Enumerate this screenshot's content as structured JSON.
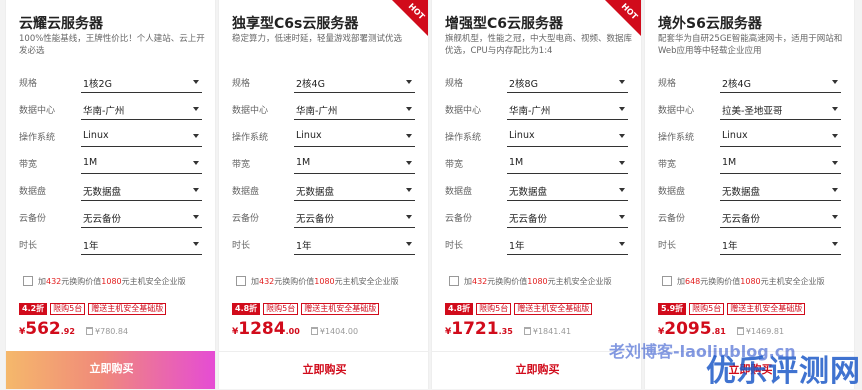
{
  "cards": [
    {
      "title": "云耀云服务器",
      "desc": "100%性能基线，王牌性价比！个人建站、云上开发必选",
      "hot": false,
      "specs": [
        {
          "label": "规格",
          "value": "1核2G"
        },
        {
          "label": "数据中心",
          "value": "华南-广州"
        },
        {
          "label": "操作系统",
          "value": "Linux"
        },
        {
          "label": "带宽",
          "value": "1M"
        },
        {
          "label": "数据盘",
          "value": "无数据盘"
        },
        {
          "label": "云备份",
          "value": "无云备份"
        },
        {
          "label": "时长",
          "value": "1年"
        }
      ],
      "addon": {
        "pre": "加",
        "price": "432",
        "mid": "元换购价值",
        "value": "1080",
        "post": "元主机安全企业版"
      },
      "discount": "4.2折",
      "tag_limit": "限购5台",
      "tag_gift": "赠送主机安全基础版",
      "price_cur": "¥",
      "price_int": "562",
      "price_dec": ".92",
      "orig_price": "¥780.84",
      "buy_label": "立即购买",
      "primary": true
    },
    {
      "title": "独享型C6s云服务器",
      "desc": "稳定算力，低速时延，轻量游戏部署测试优选",
      "hot": true,
      "specs": [
        {
          "label": "规格",
          "value": "2核4G"
        },
        {
          "label": "数据中心",
          "value": "华南-广州"
        },
        {
          "label": "操作系统",
          "value": "Linux"
        },
        {
          "label": "带宽",
          "value": "1M"
        },
        {
          "label": "数据盘",
          "value": "无数据盘"
        },
        {
          "label": "云备份",
          "value": "无云备份"
        },
        {
          "label": "时长",
          "value": "1年"
        }
      ],
      "addon": {
        "pre": "加",
        "price": "432",
        "mid": "元换购价值",
        "value": "1080",
        "post": "元主机安全企业版"
      },
      "discount": "4.8折",
      "tag_limit": "限购5台",
      "tag_gift": "赠送主机安全基础版",
      "price_cur": "¥",
      "price_int": "1284",
      "price_dec": ".00",
      "orig_price": "¥1404.00",
      "buy_label": "立即购买",
      "primary": false
    },
    {
      "title": "增强型C6云服务器",
      "desc": "旗舰机型，性能之冠，中大型电商、视频、数据库优选，CPU与内存配比为1:4",
      "hot": true,
      "specs": [
        {
          "label": "规格",
          "value": "2核8G"
        },
        {
          "label": "数据中心",
          "value": "华南-广州"
        },
        {
          "label": "操作系统",
          "value": "Linux"
        },
        {
          "label": "带宽",
          "value": "1M"
        },
        {
          "label": "数据盘",
          "value": "无数据盘"
        },
        {
          "label": "云备份",
          "value": "无云备份"
        },
        {
          "label": "时长",
          "value": "1年"
        }
      ],
      "addon": {
        "pre": "加",
        "price": "432",
        "mid": "元换购价值",
        "value": "1080",
        "post": "元主机安全企业版"
      },
      "discount": "4.8折",
      "tag_limit": "限购5台",
      "tag_gift": "赠送主机安全基础版",
      "price_cur": "¥",
      "price_int": "1721",
      "price_dec": ".35",
      "orig_price": "¥1841.41",
      "buy_label": "立即购买",
      "primary": false
    },
    {
      "title": "境外S6云服务器",
      "desc": "配套华为自研25GE智能高速网卡，适用于网站和Web应用等中轻载企业应用",
      "hot": false,
      "specs": [
        {
          "label": "规格",
          "value": "2核4G"
        },
        {
          "label": "数据中心",
          "value": "拉美-圣地亚哥"
        },
        {
          "label": "操作系统",
          "value": "Linux"
        },
        {
          "label": "带宽",
          "value": "1M"
        },
        {
          "label": "数据盘",
          "value": "无数据盘"
        },
        {
          "label": "云备份",
          "value": "无云备份"
        },
        {
          "label": "时长",
          "value": "1年"
        }
      ],
      "addon": {
        "pre": "加",
        "price": "648",
        "mid": "元换购价值",
        "value": "1080",
        "post": "元主机安全企业版"
      },
      "discount": "5.9折",
      "tag_limit": "限购5台",
      "tag_gift": "赠送主机安全基础版",
      "price_cur": "¥",
      "price_int": "2095",
      "price_dec": ".81",
      "orig_price": "¥1469.81",
      "buy_label": "立即购买",
      "primary": false
    }
  ],
  "hot_label": "HOT",
  "watermark_small": "老刘博客-laoliublog.cn",
  "watermark_large": "优乐评测网",
  "colors": {
    "accent": "#d10b1b",
    "gradient_start": "#f5b86b",
    "gradient_end": "#e54bd6"
  }
}
